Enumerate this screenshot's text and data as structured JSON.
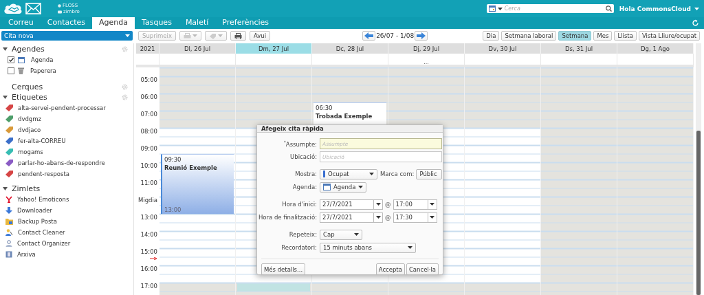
{
  "header": {
    "brand": [
      "FLOSS",
      "zimbro"
    ],
    "search": {
      "placeholder": "Cerca"
    },
    "user": "Hola CommonsCloud"
  },
  "tabs": [
    {
      "label": "Correu",
      "selected": false
    },
    {
      "label": "Contactes",
      "selected": false
    },
    {
      "label": "Agenda",
      "selected": true
    },
    {
      "label": "Tasques",
      "selected": false
    },
    {
      "label": "Maletí",
      "selected": false
    },
    {
      "label": "Preferències",
      "selected": false
    }
  ],
  "toolbar": {
    "new": "Cita nova",
    "buttons": [
      {
        "kind": "text",
        "label": "Suprimeix",
        "disabled": true
      },
      {
        "kind": "print-menu",
        "disabled": true
      },
      {
        "kind": "tag-menu",
        "disabled": true
      },
      {
        "kind": "print",
        "disabled": false
      },
      {
        "kind": "text",
        "label": "Avui",
        "disabled": false
      }
    ],
    "range": "26/07 - 1/08",
    "views": [
      {
        "label": "Dia",
        "selected": false
      },
      {
        "label": "Setmana laboral",
        "selected": false
      },
      {
        "label": "Setmana",
        "selected": true
      },
      {
        "label": "Mes",
        "selected": false
      },
      {
        "label": "Llista",
        "selected": false
      },
      {
        "label": "Vista Lliure/ocupat",
        "selected": false
      }
    ]
  },
  "sidebar": {
    "sections": [
      {
        "title": "Agendes",
        "kind": "calendars",
        "expanded": true,
        "gear": true,
        "items": [
          {
            "label": "Agenda",
            "kind": "calendar",
            "checked": true
          },
          {
            "label": "Paperera",
            "kind": "trash",
            "checked": false
          }
        ]
      },
      {
        "title": "Cerques",
        "kind": "searches",
        "gear": true
      },
      {
        "title": "Etiquetes",
        "kind": "tags",
        "expanded": true,
        "gear": true,
        "items": [
          {
            "label": "alta-servei-pendent-processar",
            "color": "#d64545"
          },
          {
            "label": "dvdgmz",
            "color": "#4e9e6a"
          },
          {
            "label": "dvdjaco",
            "color": "#d99a3a"
          },
          {
            "label": "fer-alta-CORREU",
            "color": "#3b6fc9"
          },
          {
            "label": "mogams",
            "color": "#37bdb3"
          },
          {
            "label": "parlar-ho-abans-de-respondre",
            "color": "#8a5bc4"
          },
          {
            "label": "pendent-resposta",
            "color": "#d64545"
          }
        ]
      },
      {
        "title": "Zimlets",
        "kind": "zimlets",
        "expanded": true,
        "items": [
          {
            "label": "Yahoo! Emoticons",
            "kind": "yahoo"
          },
          {
            "label": "Downloader",
            "kind": "download"
          },
          {
            "label": "Backup Posta",
            "kind": "backup"
          },
          {
            "label": "Contact Cleaner",
            "kind": "cleaner"
          },
          {
            "label": "Contact Organizer",
            "kind": "organizer"
          },
          {
            "label": "Arxiva",
            "kind": "archive"
          }
        ]
      }
    ]
  },
  "calendar": {
    "year": "2021",
    "hours": [
      "05:00",
      "06:00",
      "07:00",
      "08:00",
      "09:00",
      "10:00",
      "11:00",
      "Migdia",
      "13:00",
      "14:00",
      "15:00",
      "16:00",
      "17:00"
    ],
    "days": [
      {
        "label": "Dl, 26 Jul",
        "selected": false,
        "working": true,
        "events": [
          {
            "start": "09:30",
            "title": "Reunió Exemple",
            "end": "13:00"
          }
        ]
      },
      {
        "label": "Dm, 27 Jul",
        "selected": true,
        "working": true
      },
      {
        "label": "Dc, 28 Jul",
        "selected": false,
        "working": true,
        "events": [
          {
            "start": "06:30",
            "title": "Trobada Exemple"
          }
        ]
      },
      {
        "label": "Dj, 29 Jul",
        "selected": false,
        "working": true,
        "more": "..."
      },
      {
        "label": "Dv, 30 Jul",
        "selected": false,
        "working": true
      },
      {
        "label": "Ds, 31 Jul",
        "selected": false,
        "working": false
      },
      {
        "label": "Dg, 1 Ago",
        "selected": false,
        "working": false
      }
    ]
  },
  "dialog": {
    "title": "Afegeix cita ràpida",
    "rows": [
      {
        "kind": "text",
        "label": "$^{*}$Assumpte:",
        "placeholder": "Assumpte",
        "required": true
      },
      {
        "kind": "text",
        "label": "Ubicació:",
        "placeholder": "Ubicació",
        "required": false
      },
      {
        "kind": "status-select",
        "label": "Mostra:",
        "value": "Ocupat",
        "extra": {
          "label": "Marca com:",
          "value": "Públic"
        }
      },
      {
        "kind": "calendar-select",
        "label": "Agenda:",
        "value": "Agenda"
      },
      {
        "kind": "datetime",
        "label": "Hora d'inici:",
        "date": "27/7/2021",
        "at": "@",
        "time": "17:00"
      },
      {
        "kind": "datetime",
        "label": "Hora de finalització:",
        "date": "27/7/2021",
        "at": "@",
        "time": "17:30"
      },
      {
        "kind": "select",
        "label": "Repeteix:",
        "value": "Cap"
      },
      {
        "kind": "select",
        "label": "Recordatori:",
        "value": "15 minuts abans"
      }
    ],
    "left_buttons": [
      "Més detalls..."
    ],
    "right_buttons": [
      "Accepta",
      "Cancel·la"
    ]
  }
}
